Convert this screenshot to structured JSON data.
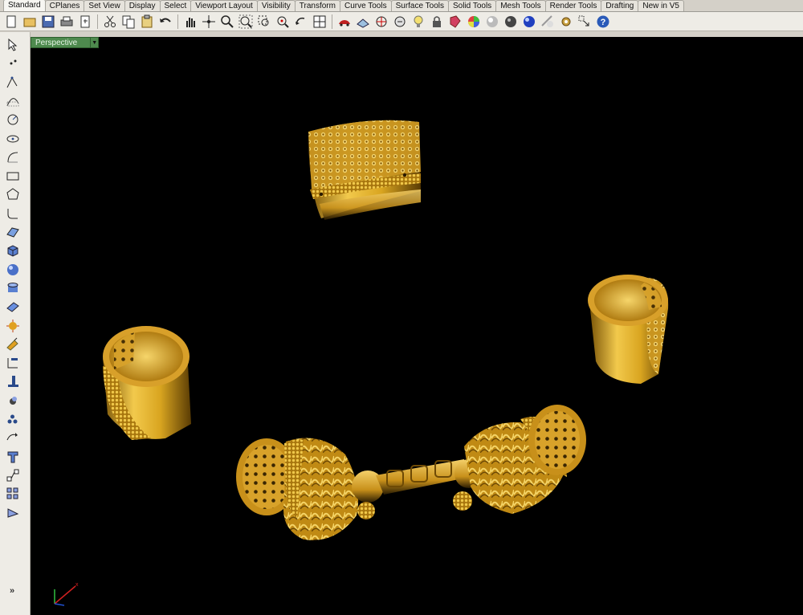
{
  "tabs": [
    "Standard",
    "CPlanes",
    "Set View",
    "Display",
    "Select",
    "Viewport Layout",
    "Visibility",
    "Transform",
    "Curve Tools",
    "Surface Tools",
    "Solid Tools",
    "Mesh Tools",
    "Render Tools",
    "Drafting",
    "New in V5"
  ],
  "active_tab": "Standard",
  "toolbar_icons": [
    "new-icon",
    "open-icon",
    "save-icon",
    "print-icon",
    "import-icon",
    "cut-icon",
    "copy-icon",
    "paste-icon",
    "undo-icon",
    "pan-icon",
    "rotate-view-icon",
    "zoom-icon",
    "zoom-extents-icon",
    "zoom-window-icon",
    "zoom-selected-icon",
    "undo-view-icon",
    "four-viewports-icon",
    "car-icon",
    "cplane-icon",
    "object-snap-icon",
    "select-icon",
    "light-icon",
    "lock-icon",
    "properties-icon",
    "color-wheel-icon",
    "sphere-shaded-icon",
    "sphere-dark-icon",
    "sphere-blue-icon",
    "render-icon",
    "settings-icon",
    "options-icon",
    "help-icon"
  ],
  "left_icons": [
    "select-arrow-icon",
    "point-icon",
    "polyline-icon",
    "curve-icon",
    "circle-icon",
    "ellipse-icon",
    "arc-icon",
    "rectangle-icon",
    "polygon-icon",
    "fillet-curve-icon",
    "surface-icon",
    "box-icon",
    "sphere-icon",
    "cylinder-icon",
    "extrude-icon",
    "explode-icon",
    "boolean-icon",
    "dimension-icon",
    "group-icon",
    "array-icon",
    "rotate-icon",
    "text-icon",
    "block-icon",
    "layers-icon",
    "snap-icon",
    "distance-icon"
  ],
  "viewport": {
    "label": "Perspective",
    "background": "#000000",
    "accent": "#4e8a4e"
  },
  "colors": {
    "gold_light": "#f2c94c",
    "gold_mid": "#d9a520",
    "gold_dark": "#6b4a06",
    "toolbar_bg": "#eeece6"
  },
  "more_label": "»"
}
